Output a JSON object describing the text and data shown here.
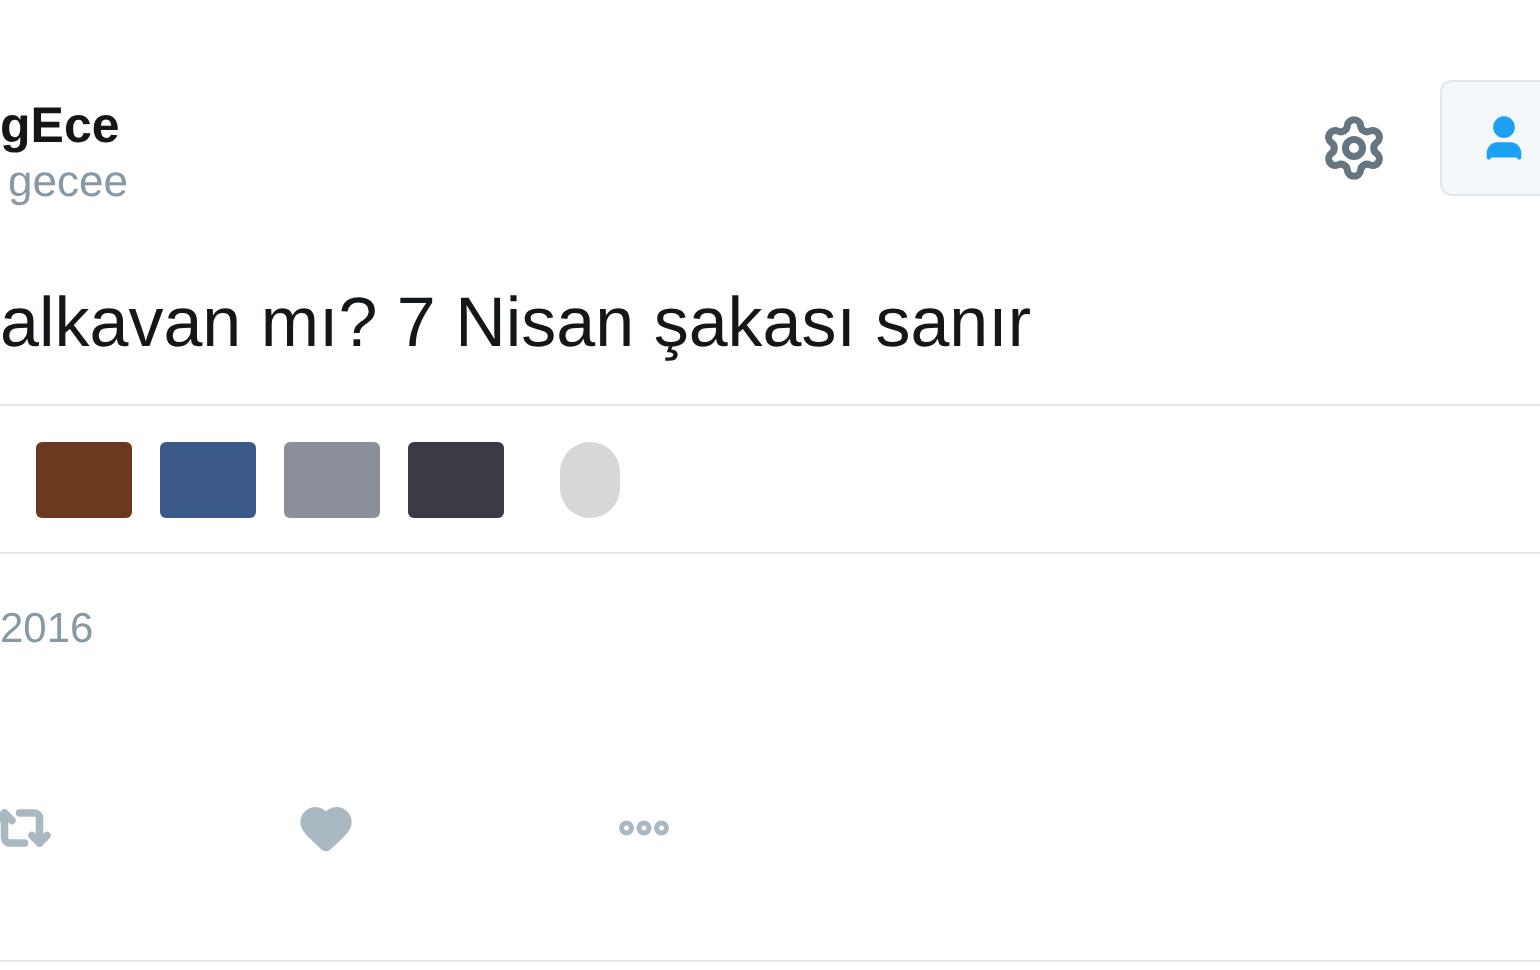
{
  "user": {
    "name": "gEce",
    "handle": "gecee"
  },
  "tweet": {
    "text": "alkavan mı? 7 Nisan şakası sanır"
  },
  "likers": [
    {
      "kind": "square"
    },
    {
      "kind": "square"
    },
    {
      "kind": "square"
    },
    {
      "kind": "square"
    },
    {
      "kind": "round"
    }
  ],
  "date": "2016"
}
